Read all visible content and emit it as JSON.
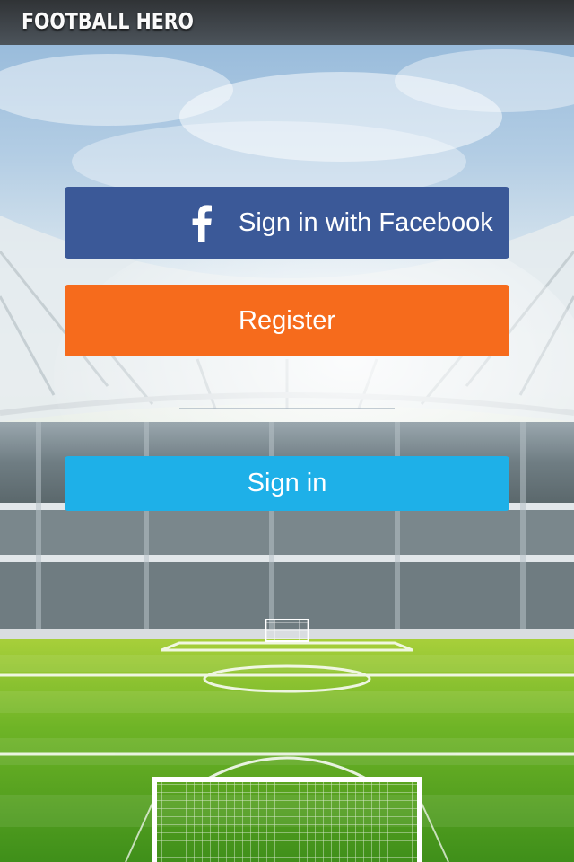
{
  "header": {
    "brand": "FOOTBALL HERO"
  },
  "auth": {
    "facebook_label": "Sign in with Facebook",
    "register_label": "Register",
    "signin_label": "Sign in"
  },
  "colors": {
    "facebook": "#3b5998",
    "register": "#f66b1c",
    "signin": "#1eb0e8",
    "header_bg": "#333333"
  },
  "icons": {
    "facebook": "facebook-f-icon"
  }
}
